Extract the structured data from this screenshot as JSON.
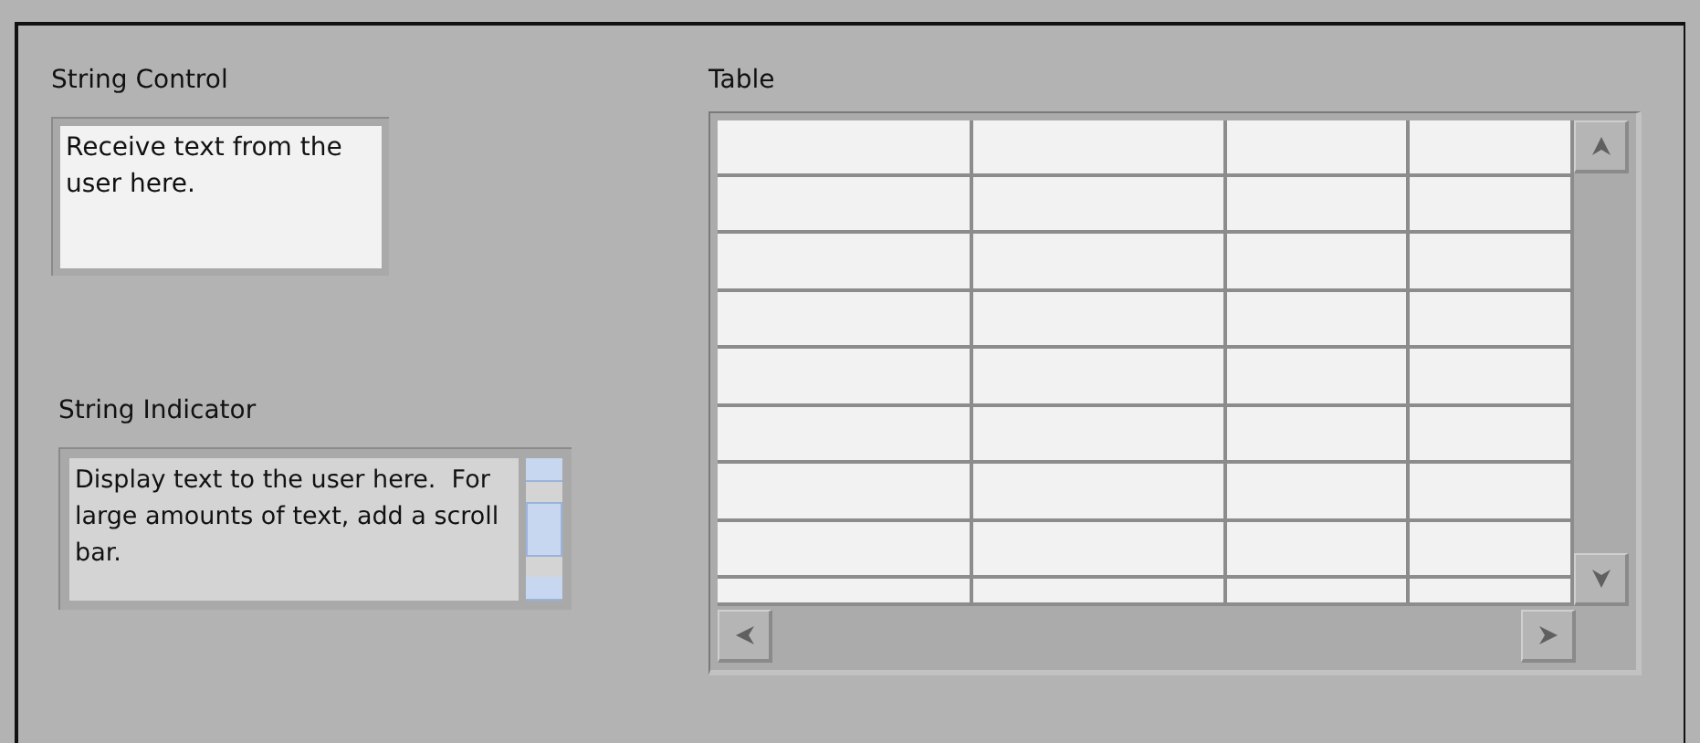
{
  "string_control": {
    "label": "String Control",
    "value": "Receive text from the user here."
  },
  "string_indicator": {
    "label": "String Indicator",
    "value": "Display text to the user here.  For large amounts of text, add a scroll bar."
  },
  "table": {
    "label": "Table"
  }
}
